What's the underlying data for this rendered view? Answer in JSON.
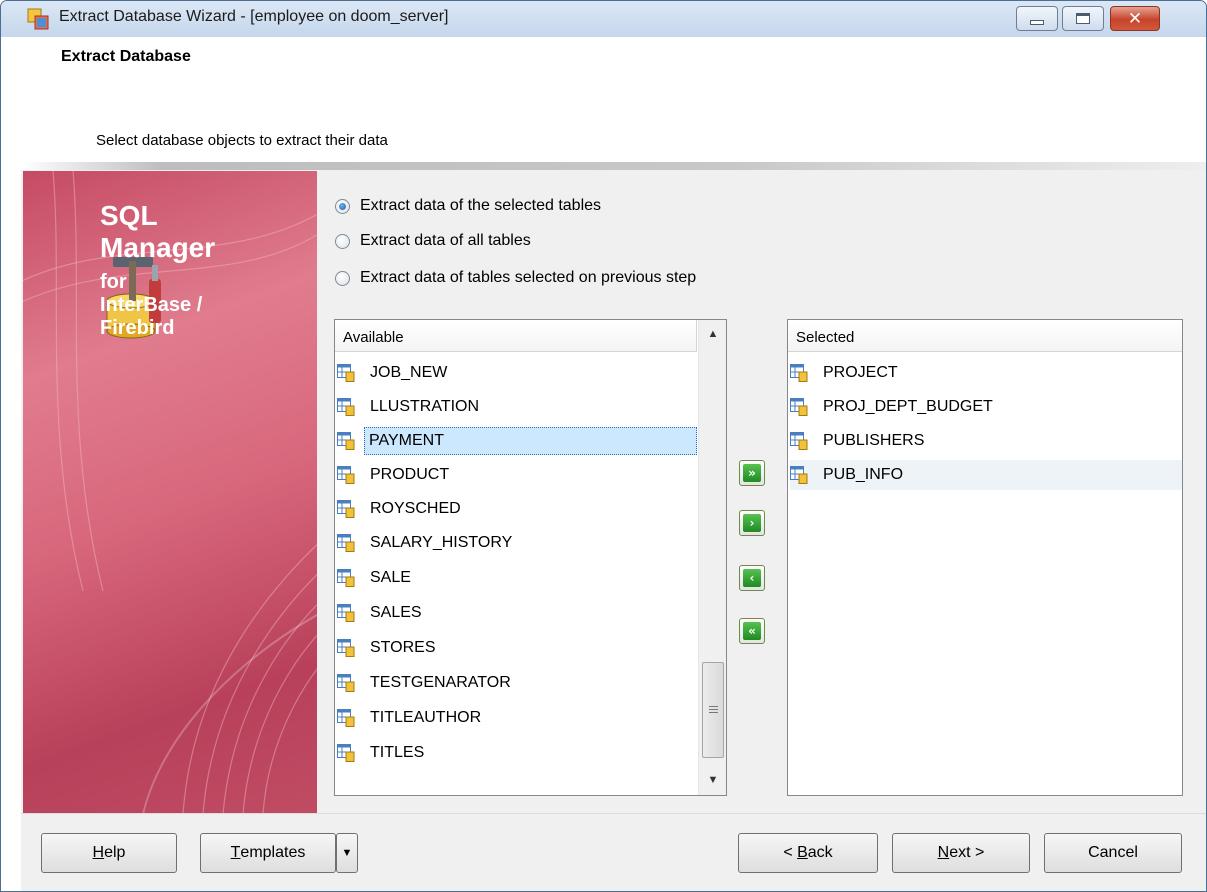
{
  "window": {
    "title": "Extract Database Wizard - [employee on doom_server]",
    "close_glyph": "✕"
  },
  "header": {
    "title": "Extract Database",
    "subtitle": "Select database objects to extract their data"
  },
  "branding": {
    "line1": "SQL",
    "line2": "Manager",
    "line3": "for",
    "line4": "InterBase /",
    "line5": "Firebird",
    "icon": "database-tools-icon"
  },
  "options": [
    {
      "label": "Extract data of the selected tables",
      "checked": true
    },
    {
      "label": "Extract data of all tables",
      "checked": false
    },
    {
      "label": "Extract data of tables selected on  previous step",
      "checked": false
    }
  ],
  "available": {
    "header": "Available",
    "items": [
      "JOB_NEW",
      "LLUSTRATION",
      "PAYMENT",
      "PRODUCT",
      "ROYSCHED",
      "SALARY_HISTORY",
      "SALE",
      "SALES",
      "STORES",
      "TESTGENARATOR",
      "TITLEAUTHOR",
      "TITLES"
    ],
    "selected_item": "PAYMENT"
  },
  "selected": {
    "header": "Selected",
    "items": [
      "PROJECT",
      "PROJ_DEPT_BUDGET",
      "PUBLISHERS",
      "PUB_INFO"
    ],
    "hover_item": "PUB_INFO"
  },
  "move_buttons": {
    "add_all": "»",
    "add": "›",
    "remove": "‹",
    "remove_all": "«"
  },
  "footer": {
    "help": {
      "u": "H",
      "rest": "elp"
    },
    "templates": {
      "u": "T",
      "rest": "emplates"
    },
    "dropdown": "▼",
    "back": {
      "pre": "< ",
      "u": "B",
      "rest": "ack"
    },
    "next": {
      "u": "N",
      "rest": "ext >"
    },
    "cancel": "Cancel"
  },
  "scrollbar": {
    "up": "▲",
    "down": "▼"
  },
  "colors": {
    "accent": "#c54b64",
    "selection": "#cce8ff",
    "move_button": "#2a9a2c"
  }
}
